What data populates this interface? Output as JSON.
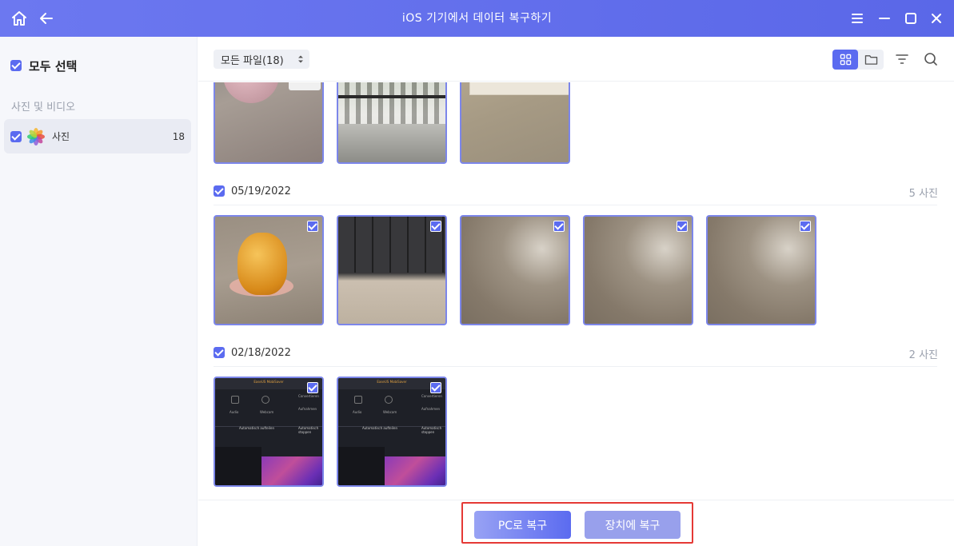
{
  "window": {
    "title": "iOS 기기에서 데이터 복구하기",
    "accent": "#5b6bf0"
  },
  "sidebar": {
    "select_all_label": "모두 선택",
    "section_label": "사진 및 비디오",
    "items": [
      {
        "label": "사진",
        "count": "18",
        "icon": "photos-icon",
        "checked": true
      }
    ]
  },
  "toolbar": {
    "filter_value": "모든 파일(18)",
    "view_modes": [
      "grid-view-icon",
      "folder-view-icon"
    ],
    "tools": [
      "filter-icon",
      "search-icon"
    ]
  },
  "groups": [
    {
      "date": "",
      "count": "",
      "photos": [
        "bottle",
        "fence",
        "box"
      ],
      "checked": true
    },
    {
      "date": "05/19/2022",
      "count": "5 사진",
      "photos": [
        "orange",
        "keyboard",
        "table",
        "table",
        "table"
      ],
      "checked": true
    },
    {
      "date": "02/18/2022",
      "count": "2 사진",
      "photos": [
        "screen",
        "screen"
      ],
      "checked": true
    }
  ],
  "screen_thumb": {
    "header": "EaseUS MobiSaver",
    "labels": [
      "Audio",
      "Webcam",
      "Convertieren",
      "Aufnahmen",
      "Automatisch aufteilen",
      "Automatisch stoppen"
    ]
  },
  "bottom": {
    "recover_pc": "PC로 복구",
    "recover_device": "장치에 복구"
  }
}
